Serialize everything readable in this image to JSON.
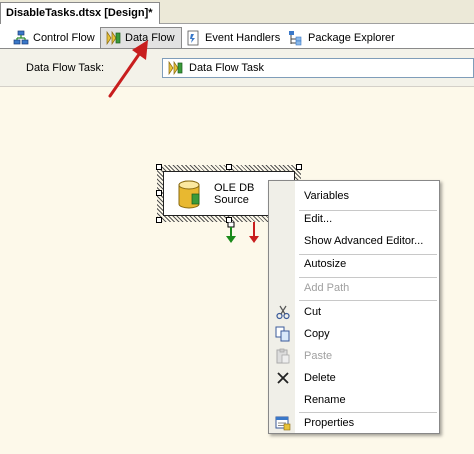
{
  "document_tab": {
    "title": "DisableTasks.dtsx [Design]*"
  },
  "designer_tabs": [
    {
      "label": "Control Flow",
      "icon": "control-flow-icon",
      "active": false
    },
    {
      "label": "Data Flow",
      "icon": "data-flow-icon",
      "active": true
    },
    {
      "label": "Event Handlers",
      "icon": "event-handlers-icon",
      "active": false
    },
    {
      "label": "Package Explorer",
      "icon": "package-explorer-icon",
      "active": false
    }
  ],
  "task_bar": {
    "label": "Data Flow Task:",
    "selected_task": "Data Flow Task"
  },
  "component": {
    "line1": "OLE DB",
    "line2": "Source",
    "icon": "database-icon"
  },
  "context_menu": {
    "items": [
      {
        "label": "Variables",
        "icon": "",
        "enabled": true
      },
      {
        "label": "Edit...",
        "icon": "",
        "enabled": true
      },
      {
        "label": "Show Advanced Editor...",
        "icon": "",
        "enabled": true
      },
      {
        "label": "Autosize",
        "icon": "",
        "enabled": true
      },
      {
        "label": "Add Path",
        "icon": "",
        "enabled": false
      },
      {
        "label": "Cut",
        "icon": "scissors-icon",
        "enabled": true
      },
      {
        "label": "Copy",
        "icon": "copy-icon",
        "enabled": true
      },
      {
        "label": "Paste",
        "icon": "paste-icon",
        "enabled": false
      },
      {
        "label": "Delete",
        "icon": "delete-x-icon",
        "enabled": true
      },
      {
        "label": "Rename",
        "icon": "",
        "enabled": true
      },
      {
        "label": "Properties",
        "icon": "properties-icon",
        "enabled": true
      }
    ]
  },
  "colors": {
    "canvas_bg": "#fdf9ea",
    "success_path": "#1a8a1a",
    "error_path": "#c81e1e",
    "annotation_arrow": "#c81e1e"
  }
}
